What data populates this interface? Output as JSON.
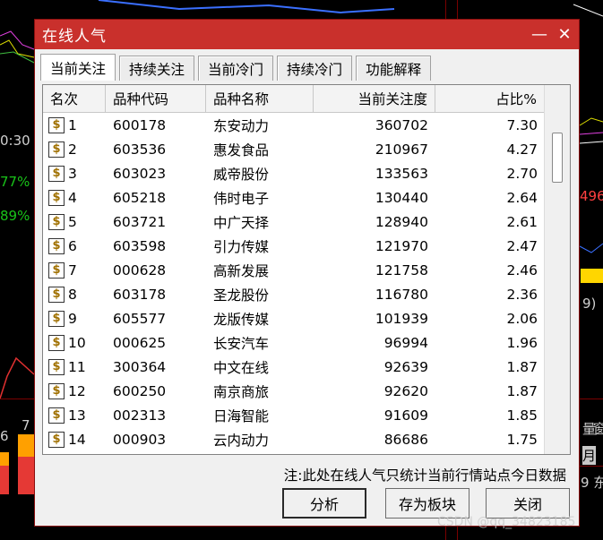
{
  "background": {
    "fragments": [
      {
        "text": "0:30",
        "color": "#d0d0d0"
      },
      {
        "text": "77%",
        "color": "#19c319"
      },
      {
        "text": "89%",
        "color": "#19c319"
      },
      {
        "text": "6",
        "color": "#d0d0d0"
      },
      {
        "text": "7",
        "color": "#d0d0d0"
      },
      {
        "text": "496",
        "color": "#ff4040"
      },
      {
        "text": "9)",
        "color": "#d0d0d0"
      },
      {
        "text": "量",
        "color": "#d0d0d0"
      },
      {
        "text": "窗",
        "color": "#d0d0d0"
      },
      {
        "text": "月",
        "color": "#000000"
      },
      {
        "text": "9 东",
        "color": "#d0d0d0"
      }
    ]
  },
  "dialog": {
    "title": "在线人气",
    "minimize_symbol": "—",
    "close_symbol": "✕",
    "tabs": [
      "当前关注",
      "持续关注",
      "当前冷门",
      "持续冷门",
      "功能解释"
    ],
    "columns": [
      "名次",
      "品种代码",
      "品种名称",
      "当前关注度",
      "占比%"
    ],
    "rows": [
      {
        "rank": "1",
        "code": "600178",
        "name": "东安动力",
        "attention": "360702",
        "pct": "7.30"
      },
      {
        "rank": "2",
        "code": "603536",
        "name": "惠发食品",
        "attention": "210967",
        "pct": "4.27"
      },
      {
        "rank": "3",
        "code": "603023",
        "name": "威帝股份",
        "attention": "133563",
        "pct": "2.70"
      },
      {
        "rank": "4",
        "code": "605218",
        "name": "伟时电子",
        "attention": "130440",
        "pct": "2.64"
      },
      {
        "rank": "5",
        "code": "603721",
        "name": "中广天择",
        "attention": "128940",
        "pct": "2.61"
      },
      {
        "rank": "6",
        "code": "603598",
        "name": "引力传媒",
        "attention": "121970",
        "pct": "2.47"
      },
      {
        "rank": "7",
        "code": "000628",
        "name": "高新发展",
        "attention": "121758",
        "pct": "2.46"
      },
      {
        "rank": "8",
        "code": "603178",
        "name": "圣龙股份",
        "attention": "116780",
        "pct": "2.36"
      },
      {
        "rank": "9",
        "code": "605577",
        "name": "龙版传媒",
        "attention": "101939",
        "pct": "2.06"
      },
      {
        "rank": "10",
        "code": "000625",
        "name": "长安汽车",
        "attention": "96994",
        "pct": "1.96"
      },
      {
        "rank": "11",
        "code": "300364",
        "name": "中文在线",
        "attention": "92639",
        "pct": "1.87"
      },
      {
        "rank": "12",
        "code": "600250",
        "name": "南京商旅",
        "attention": "92620",
        "pct": "1.87"
      },
      {
        "rank": "13",
        "code": "002313",
        "name": "日海智能",
        "attention": "91609",
        "pct": "1.85"
      },
      {
        "rank": "14",
        "code": "000903",
        "name": "云内动力",
        "attention": "86686",
        "pct": "1.75"
      }
    ],
    "note": "注:此处在线人气只统计当前行情站点今日数据",
    "buttons": {
      "analyze": "分析",
      "save_block": "存为板块",
      "close": "关闭"
    }
  },
  "watermark": "CSDN @qq_34823185",
  "colors": {
    "title_bar": "#c9302c",
    "coin_icon": "#a07000"
  }
}
